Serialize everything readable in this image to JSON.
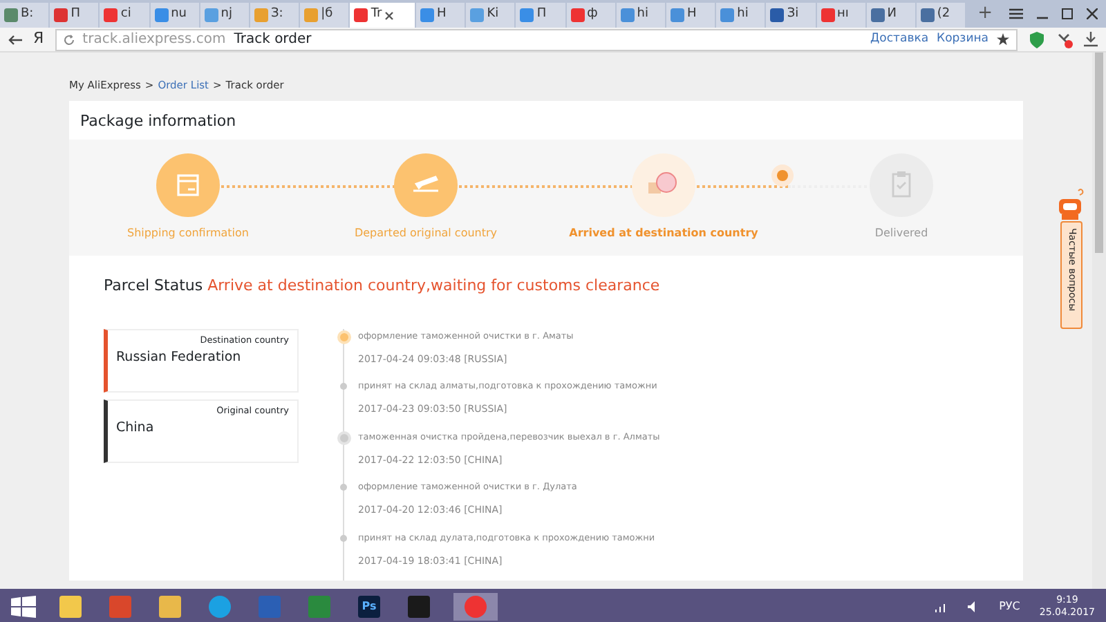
{
  "browser": {
    "tabs": [
      {
        "label": "В:",
        "selected": false
      },
      {
        "label": "П",
        "selected": false
      },
      {
        "label": "сі",
        "selected": false
      },
      {
        "label": "nu",
        "selected": false
      },
      {
        "label": "nj",
        "selected": false
      },
      {
        "label": "З:",
        "selected": false
      },
      {
        "label": "|б",
        "selected": false
      },
      {
        "label": "Tr",
        "selected": true
      },
      {
        "label": "Н",
        "selected": false
      },
      {
        "label": "Ki",
        "selected": false
      },
      {
        "label": "П",
        "selected": false
      },
      {
        "label": "ф",
        "selected": false
      },
      {
        "label": "hi",
        "selected": false
      },
      {
        "label": "Н",
        "selected": false
      },
      {
        "label": "hi",
        "selected": false
      },
      {
        "label": "Зі",
        "selected": false
      },
      {
        "label": "нı",
        "selected": false
      },
      {
        "label": "И",
        "selected": false
      },
      {
        "label": "(2",
        "selected": false
      }
    ],
    "new_tab": "+",
    "logo": "Я",
    "url": "track.aliexpress.com",
    "page_title": "Track order",
    "links": [
      "Доставка",
      "Корзина"
    ]
  },
  "breadcrumb_separator": ">",
  "breadcrumb": [
    {
      "label": "My AliExpress",
      "link": false
    },
    {
      "label": "Order List",
      "link": true
    },
    {
      "label": "Track order",
      "link": false
    }
  ],
  "panel_title": "Package information",
  "steps": [
    {
      "label": "Shipping confirmation",
      "completed": true,
      "current": false,
      "kind": "box"
    },
    {
      "label": "Departed original country",
      "completed": true,
      "current": false,
      "kind": "plane"
    },
    {
      "label": "Arrived at destination country",
      "completed": false,
      "current": true,
      "kind": "stamp"
    },
    {
      "label": "Delivered",
      "completed": false,
      "current": false,
      "kind": "clipboard"
    }
  ],
  "parcel_status": {
    "label": "Parcel Status",
    "value": "Arrive at destination country,waiting for customs clearance"
  },
  "countries": [
    {
      "caption": "Destination country",
      "name": "Russian Federation",
      "color": "#e5532e"
    },
    {
      "caption": "Original country",
      "name": "China",
      "color": "#333333"
    }
  ],
  "events": [
    {
      "text": "оформление таможенной очистки в г. Аматы",
      "time": "2017-04-24 09:03:48 [RUSSIA]",
      "kind": "current"
    },
    {
      "text": "принят на склад алматы,подготовка к прохождению таможни",
      "time": "2017-04-23 09:03:50 [RUSSIA]",
      "kind": "dot"
    },
    {
      "text": "таможенная очистка пройдена,перевозчик выехал в г. Алматы",
      "time": "2017-04-22 12:03:50 [CHINA]",
      "kind": "milestone"
    },
    {
      "text": "оформление таможенной очистки в г. Дулата",
      "time": "2017-04-20 12:03:46 [CHINA]",
      "kind": "dot"
    },
    {
      "text": "принят на склад дулата,подготовка к прохождению таможни",
      "time": "2017-04-19 18:03:41 [CHINA]",
      "kind": "dot"
    }
  ],
  "help_widget": "Частые вопросы",
  "taskbar": {
    "apps": [
      {
        "kind": "folder"
      },
      {
        "kind": "cleaner"
      },
      {
        "kind": "wand"
      },
      {
        "kind": "skype"
      },
      {
        "kind": "word"
      },
      {
        "kind": "excel"
      },
      {
        "kind": "photoshop",
        "glyph": "Ps"
      },
      {
        "kind": "video"
      },
      {
        "kind": "browser",
        "selected": true
      }
    ],
    "language": "РУС",
    "time": "9:19",
    "date": "25.04.2017"
  }
}
